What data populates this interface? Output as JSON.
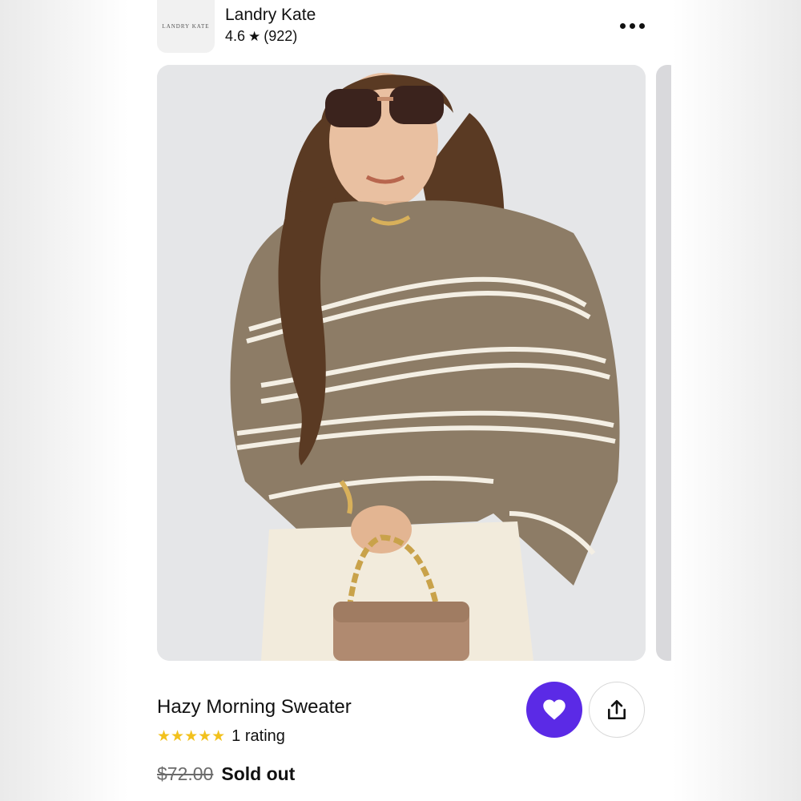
{
  "shop": {
    "logo_text": "LANDRY KATE",
    "name": "Landry Kate",
    "rating": "4.6",
    "review_count": "(922)",
    "star_icon": "star-icon"
  },
  "header": {
    "more_icon": "more-horizontal-icon"
  },
  "listing": {
    "image_alt": "Model wearing striped sweater with white jeans and a tan chain bag",
    "title": "Hazy Morning Sweater",
    "stars": "★★★★★",
    "star_count": 5,
    "rating_text": "1 rating",
    "original_price": "$72.00",
    "status": "Sold out"
  },
  "actions": {
    "favorite_icon": "heart-icon",
    "share_icon": "share-icon"
  },
  "colors": {
    "accent": "#5b2ae6",
    "star": "#f2c11c"
  }
}
